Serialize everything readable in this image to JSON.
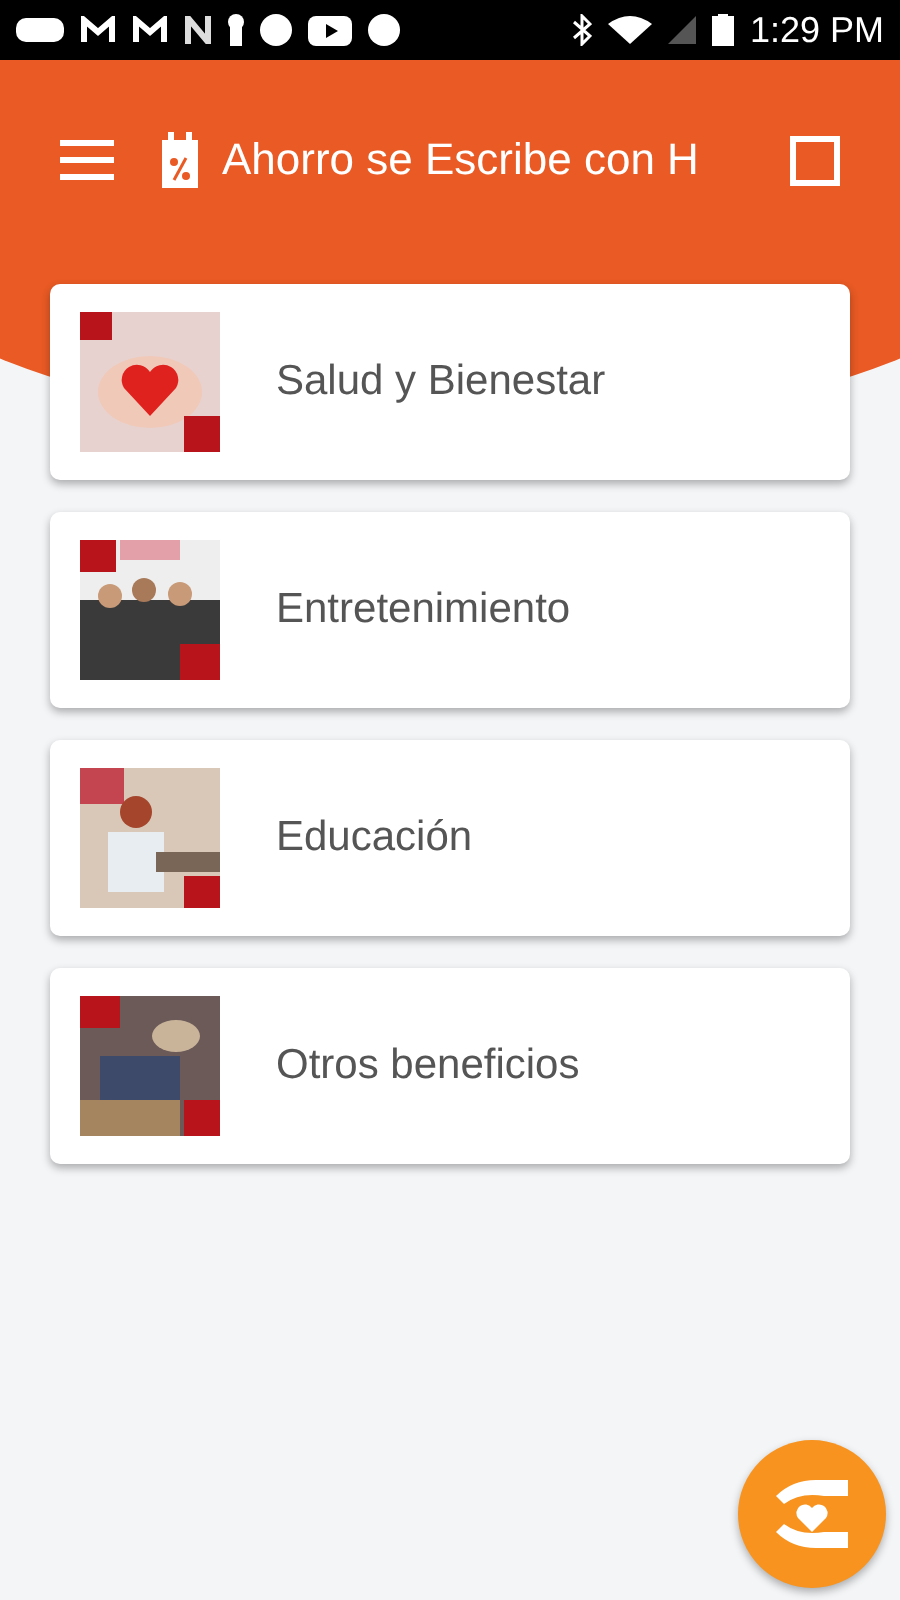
{
  "status_bar": {
    "time": "1:29 PM"
  },
  "app_bar": {
    "title": "Ahorro se Escribe con H"
  },
  "categories": [
    {
      "label": "Salud y Bienestar"
    },
    {
      "label": "Entretenimiento"
    },
    {
      "label": "Educación"
    },
    {
      "label": "Otros beneficios"
    }
  ]
}
